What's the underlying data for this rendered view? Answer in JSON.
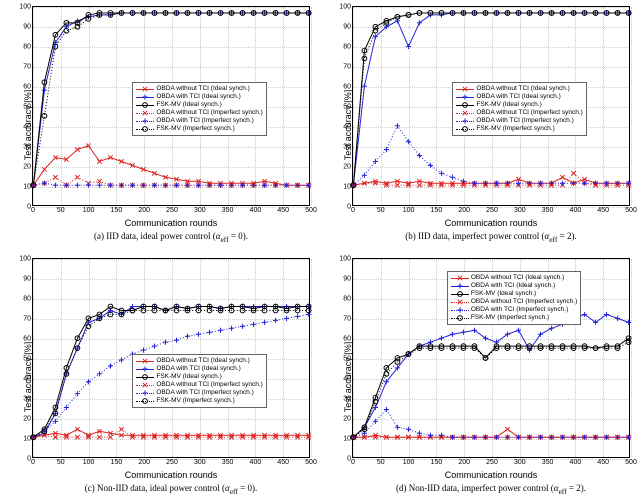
{
  "colors": {
    "red": "#d22",
    "blue": "#22d",
    "black": "#000",
    "grid": "#ccc"
  },
  "common": {
    "xlabel": "Communication rounds",
    "ylabel": "Test accuracy [%]",
    "xticks": [
      0,
      50,
      100,
      150,
      200,
      250,
      300,
      350,
      400,
      450,
      500
    ],
    "yticks": [
      0,
      10,
      20,
      30,
      40,
      50,
      60,
      70,
      80,
      90,
      100
    ],
    "xlim": [
      0,
      500
    ],
    "ylim": [
      0,
      100
    ],
    "legend": [
      {
        "name": "OBDA without TCI (Ideal synch.)",
        "color": "red",
        "marker": "x",
        "dash": "solid"
      },
      {
        "name": "OBDA with TCI (Ideal synch.)",
        "color": "blue",
        "marker": "plus",
        "dash": "solid"
      },
      {
        "name": "FSK-MV (Ideal synch.)",
        "color": "black",
        "marker": "o",
        "dash": "solid"
      },
      {
        "name": "OBDA without TCI (Imperfect synch.)",
        "color": "red",
        "marker": "x",
        "dash": "dot"
      },
      {
        "name": "OBDA with TCI (Imperfect synch.)",
        "color": "blue",
        "marker": "plus",
        "dash": "dot"
      },
      {
        "name": "FSK-MV (Imperfect synch.)",
        "color": "black",
        "marker": "o",
        "dash": "dot"
      }
    ]
  },
  "panels": [
    {
      "id": "a",
      "caption_prefix": "(a) IID data, ideal power control (",
      "alpha": "αeff = 0",
      "caption_suffix": ").",
      "legend_pos": {
        "left": "36%",
        "top": "38%"
      },
      "series": {
        "x": [
          0,
          20,
          40,
          60,
          80,
          100,
          120,
          140,
          160,
          180,
          200,
          220,
          240,
          260,
          280,
          300,
          320,
          340,
          360,
          380,
          400,
          420,
          440,
          460,
          480,
          500
        ],
        "obda_no_tci_ideal": [
          10,
          18,
          24,
          23,
          28,
          30,
          22,
          24,
          22,
          20,
          18,
          16,
          14,
          13,
          12,
          12,
          11,
          11,
          11,
          11,
          11,
          12,
          11,
          10,
          10,
          10
        ],
        "obda_tci_ideal": [
          10,
          58,
          82,
          90,
          93,
          95,
          96,
          96,
          97,
          97,
          97,
          97,
          97,
          97,
          97,
          97,
          97,
          97,
          97,
          97,
          97,
          97,
          97,
          97,
          97,
          97
        ],
        "fsk_mv_ideal": [
          10,
          62,
          86,
          92,
          92,
          96,
          97,
          97,
          97,
          97,
          97,
          97,
          97,
          97,
          97,
          97,
          97,
          97,
          97,
          97,
          97,
          97,
          97,
          97,
          97,
          97
        ],
        "obda_no_tci_imp": [
          10,
          11,
          14,
          10,
          14,
          11,
          12,
          10,
          10,
          10,
          10,
          10,
          10,
          10,
          10,
          10,
          10,
          10,
          10,
          10,
          10,
          10,
          10,
          10,
          10,
          10
        ],
        "obda_tci_imp": [
          10,
          11,
          10,
          10,
          10,
          10,
          10,
          10,
          10,
          10,
          10,
          10,
          10,
          10,
          10,
          10,
          10,
          10,
          10,
          10,
          10,
          10,
          10,
          10,
          10,
          10
        ],
        "fsk_mv_imp": [
          10,
          45,
          80,
          88,
          90,
          94,
          96,
          96,
          97,
          97,
          97,
          97,
          97,
          97,
          97,
          97,
          97,
          97,
          97,
          97,
          97,
          97,
          97,
          97,
          97,
          97
        ]
      }
    },
    {
      "id": "b",
      "caption_prefix": "(b) IID data, imperfect power control (",
      "alpha": "αeff = 2",
      "caption_suffix": ").",
      "legend_pos": {
        "left": "36%",
        "top": "38%"
      },
      "series": {
        "x": [
          0,
          20,
          40,
          60,
          80,
          100,
          120,
          140,
          160,
          180,
          200,
          220,
          240,
          260,
          280,
          300,
          320,
          340,
          360,
          380,
          400,
          420,
          440,
          460,
          480,
          500
        ],
        "obda_no_tci_ideal": [
          10,
          11,
          12,
          11,
          12,
          11,
          12,
          11,
          11,
          11,
          11,
          11,
          11,
          11,
          11,
          13,
          11,
          11,
          11,
          14,
          11,
          13,
          11,
          11,
          11,
          11
        ],
        "obda_tci_ideal": [
          10,
          60,
          85,
          90,
          93,
          80,
          92,
          96,
          96,
          97,
          97,
          97,
          97,
          97,
          97,
          97,
          97,
          97,
          97,
          97,
          97,
          97,
          97,
          97,
          97,
          97
        ],
        "fsk_mv_ideal": [
          10,
          78,
          90,
          93,
          95,
          96,
          97,
          97,
          97,
          97,
          97,
          97,
          97,
          97,
          97,
          97,
          97,
          97,
          97,
          97,
          97,
          97,
          97,
          97,
          97,
          97
        ],
        "obda_no_tci_imp": [
          10,
          11,
          11,
          10,
          10,
          10,
          10,
          10,
          10,
          10,
          10,
          10,
          10,
          10,
          10,
          10,
          10,
          10,
          10,
          10,
          16,
          11,
          10,
          10,
          10,
          10
        ],
        "obda_tci_imp": [
          10,
          15,
          22,
          28,
          40,
          32,
          25,
          20,
          16,
          14,
          12,
          11,
          11,
          11,
          11,
          11,
          11,
          11,
          11,
          11,
          11,
          11,
          11,
          11,
          11,
          11
        ],
        "fsk_mv_imp": [
          10,
          74,
          88,
          92,
          95,
          96,
          97,
          97,
          97,
          97,
          97,
          97,
          97,
          97,
          97,
          97,
          97,
          97,
          97,
          97,
          97,
          97,
          97,
          97,
          97,
          97
        ]
      }
    },
    {
      "id": "c",
      "caption_prefix": "(c) Non-IID data, ideal power control (",
      "alpha": "αeff = 0",
      "caption_suffix": ").",
      "legend_pos": {
        "left": "36%",
        "top": "48%"
      },
      "series": {
        "x": [
          0,
          20,
          40,
          60,
          80,
          100,
          120,
          140,
          160,
          180,
          200,
          220,
          240,
          260,
          280,
          300,
          320,
          340,
          360,
          380,
          400,
          420,
          440,
          460,
          480,
          500
        ],
        "obda_no_tci_ideal": [
          10,
          11,
          12,
          11,
          14,
          11,
          13,
          12,
          11,
          11,
          11,
          11,
          11,
          11,
          11,
          11,
          11,
          11,
          11,
          11,
          11,
          11,
          11,
          11,
          11,
          11
        ],
        "obda_tci_ideal": [
          10,
          12,
          22,
          42,
          55,
          68,
          70,
          74,
          72,
          76,
          76,
          76,
          74,
          76,
          75,
          76,
          76,
          75,
          76,
          76,
          76,
          76,
          76,
          76,
          76,
          76
        ],
        "fsk_mv_ideal": [
          10,
          14,
          25,
          45,
          60,
          70,
          72,
          76,
          74,
          74,
          76,
          76,
          74,
          76,
          75,
          76,
          76,
          75,
          76,
          76,
          75,
          76,
          76,
          75,
          76,
          76
        ],
        "obda_no_tci_imp": [
          10,
          11,
          10,
          10,
          10,
          10,
          10,
          10,
          14,
          10,
          10,
          10,
          10,
          10,
          10,
          10,
          10,
          10,
          10,
          10,
          10,
          10,
          10,
          10,
          10,
          10
        ],
        "obda_tci_imp": [
          10,
          13,
          18,
          25,
          32,
          38,
          42,
          46,
          49,
          52,
          54,
          56,
          58,
          59,
          61,
          62,
          63,
          64,
          65,
          66,
          67,
          68,
          69,
          70,
          71,
          72
        ],
        "fsk_mv_imp": [
          10,
          13,
          22,
          42,
          55,
          66,
          70,
          72,
          72,
          74,
          74,
          74,
          74,
          74,
          74,
          74,
          74,
          74,
          74,
          74,
          74,
          74,
          74,
          74,
          74,
          74
        ]
      }
    },
    {
      "id": "d",
      "caption_prefix": "(d) Non-IID data, imperfect power control (",
      "alpha": "αeff = 2",
      "caption_suffix": ").",
      "legend_pos": {
        "left": "34%",
        "top": "6%"
      },
      "series": {
        "x": [
          0,
          20,
          40,
          60,
          80,
          100,
          120,
          140,
          160,
          180,
          200,
          220,
          240,
          260,
          280,
          300,
          320,
          340,
          360,
          380,
          400,
          420,
          440,
          460,
          480,
          500
        ],
        "obda_no_tci_ideal": [
          10,
          10,
          11,
          10,
          10,
          10,
          10,
          10,
          10,
          10,
          10,
          10,
          10,
          10,
          14,
          10,
          10,
          10,
          10,
          10,
          10,
          10,
          10,
          10,
          10,
          10
        ],
        "obda_tci_ideal": [
          10,
          15,
          25,
          38,
          45,
          52,
          56,
          58,
          60,
          62,
          63,
          64,
          60,
          58,
          62,
          64,
          54,
          62,
          65,
          67,
          70,
          72,
          68,
          72,
          70,
          68
        ],
        "fsk_mv_ideal": [
          10,
          15,
          30,
          45,
          50,
          52,
          56,
          56,
          56,
          56,
          56,
          56,
          50,
          56,
          56,
          56,
          56,
          56,
          56,
          56,
          56,
          56,
          55,
          56,
          56,
          60
        ],
        "obda_no_tci_imp": [
          10,
          10,
          10,
          10,
          10,
          10,
          10,
          10,
          10,
          10,
          10,
          10,
          10,
          10,
          10,
          10,
          10,
          10,
          10,
          10,
          10,
          10,
          10,
          10,
          10,
          10
        ],
        "obda_tci_imp": [
          10,
          12,
          18,
          24,
          15,
          14,
          12,
          11,
          11,
          10,
          10,
          10,
          10,
          10,
          10,
          10,
          10,
          10,
          10,
          10,
          10,
          10,
          10,
          10,
          10,
          10
        ],
        "fsk_mv_imp": [
          10,
          14,
          28,
          42,
          48,
          52,
          55,
          55,
          55,
          55,
          55,
          55,
          50,
          55,
          55,
          55,
          55,
          55,
          55,
          55,
          55,
          55,
          55,
          55,
          55,
          58
        ]
      }
    }
  ],
  "chart_data": [
    {
      "panel": "a",
      "type": "line",
      "title": "IID data, ideal power control (αeff = 0)",
      "xlabel": "Communication rounds",
      "ylabel": "Test accuracy [%]",
      "xlim": [
        0,
        500
      ],
      "ylim": [
        0,
        100
      ]
    },
    {
      "panel": "b",
      "type": "line",
      "title": "IID data, imperfect power control (αeff = 2)",
      "xlabel": "Communication rounds",
      "ylabel": "Test accuracy [%]",
      "xlim": [
        0,
        500
      ],
      "ylim": [
        0,
        100
      ]
    },
    {
      "panel": "c",
      "type": "line",
      "title": "Non-IID data, ideal power control (αeff = 0)",
      "xlabel": "Communication rounds",
      "ylabel": "Test accuracy [%]",
      "xlim": [
        0,
        500
      ],
      "ylim": [
        0,
        100
      ]
    },
    {
      "panel": "d",
      "type": "line",
      "title": "Non-IID data, imperfect power control (αeff = 2)",
      "xlabel": "Communication rounds",
      "ylabel": "Test accuracy [%]",
      "xlim": [
        0,
        500
      ],
      "ylim": [
        0,
        100
      ]
    }
  ]
}
